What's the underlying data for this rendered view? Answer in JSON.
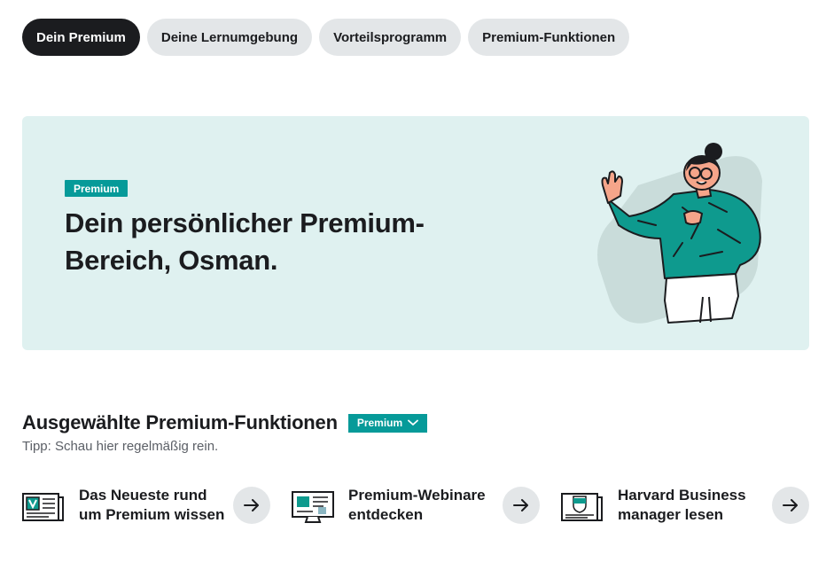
{
  "tabs": [
    {
      "label": "Dein Premium",
      "active": true
    },
    {
      "label": "Deine Lernumgebung",
      "active": false
    },
    {
      "label": "Vorteilsprogramm",
      "active": false
    },
    {
      "label": "Premium-Funktionen",
      "active": false
    }
  ],
  "hero": {
    "badge": "Premium",
    "title": "Dein persönlicher Premium-Bereich, Osman.",
    "illustration_icon": "person-waving-illustration"
  },
  "section": {
    "title": "Ausgewählte Premium-Funktionen",
    "badge": "Premium",
    "badge_icon": "chevron-down-icon",
    "tip": "Tipp: Schau hier regelmäßig rein."
  },
  "features": [
    {
      "label_line1": "Das Neueste rund",
      "label_line2": "um Premium wissen",
      "icon": "newspaper-icon",
      "action_icon": "arrow-right-icon"
    },
    {
      "label_line1": "Premium-Webinare",
      "label_line2": "entdecken",
      "icon": "monitor-webinar-icon",
      "action_icon": "arrow-right-icon"
    },
    {
      "label_line1": "Harvard Business",
      "label_line2": "manager lesen",
      "icon": "magazine-icon",
      "action_icon": "arrow-right-icon"
    }
  ],
  "colors": {
    "accent": "#069a99",
    "hero_bg": "#dff1f0",
    "tab_active": "#1b1c1f",
    "tab_inactive": "#e3e6e8"
  }
}
